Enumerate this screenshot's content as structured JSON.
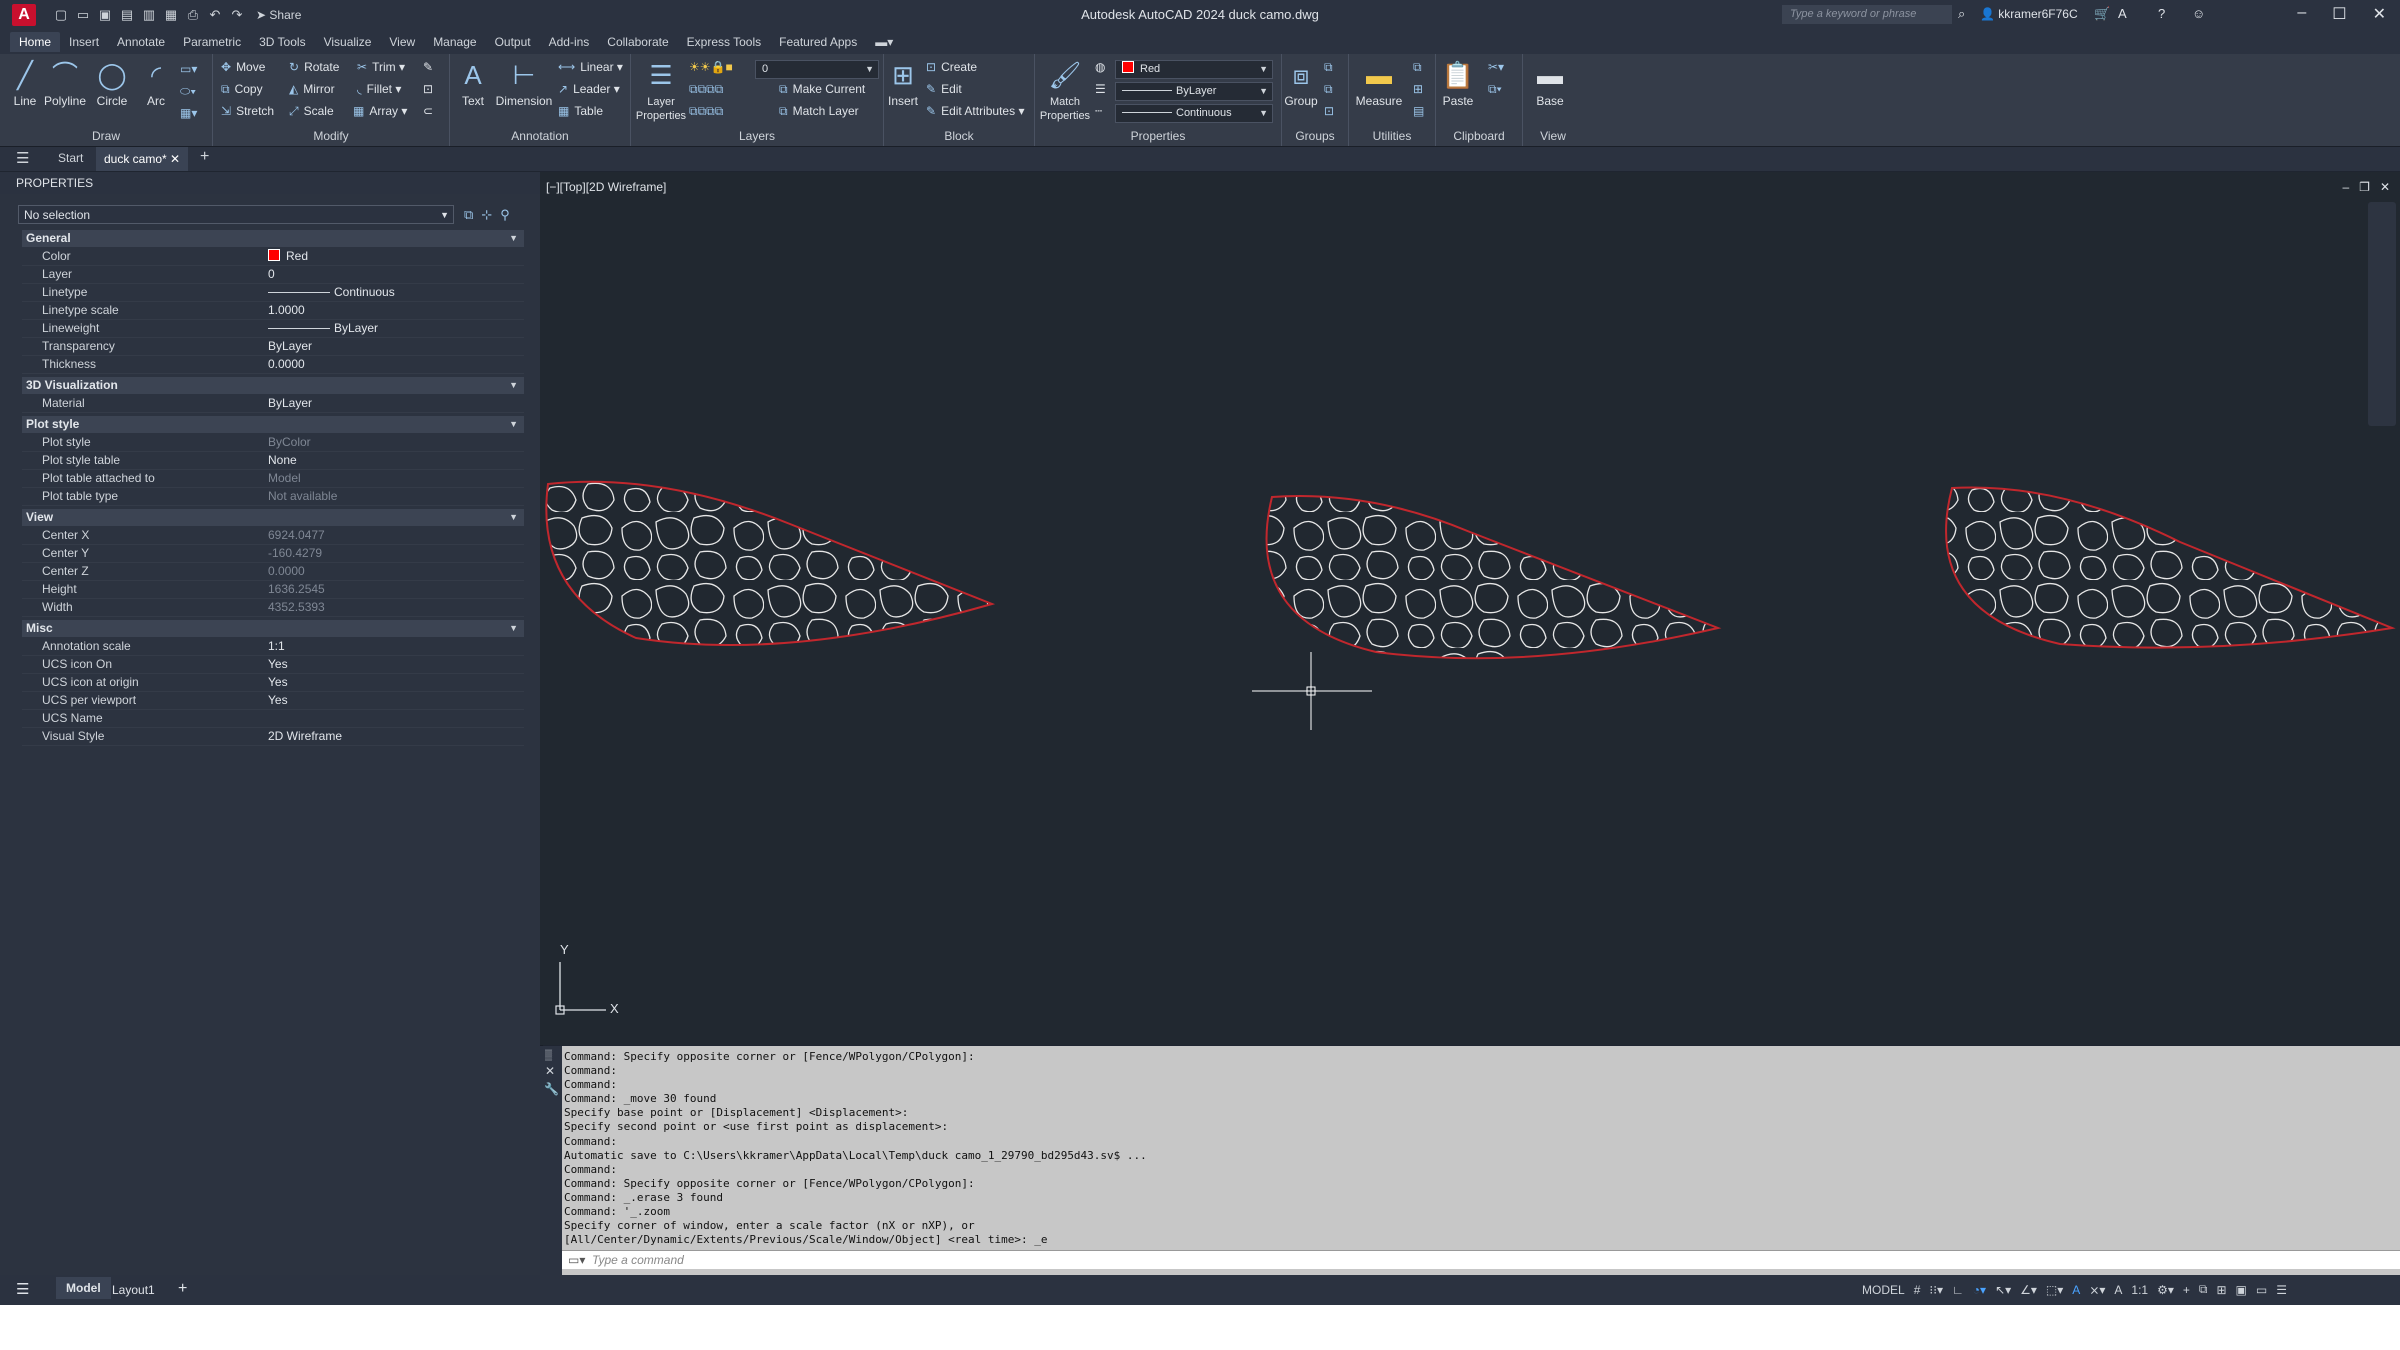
{
  "app": {
    "logo_letter": "A",
    "title": "Autodesk AutoCAD 2024   duck camo.dwg",
    "share_label": "Share",
    "search_placeholder": "Type a keyword or phrase",
    "username": "kkramer6F76C"
  },
  "menu_tabs": [
    "Home",
    "Insert",
    "Annotate",
    "Parametric",
    "3D Tools",
    "Visualize",
    "View",
    "Manage",
    "Output",
    "Add-ins",
    "Collaborate",
    "Express Tools",
    "Featured Apps"
  ],
  "ribbon": {
    "draw": {
      "title": "Draw",
      "line": "Line",
      "polyline": "Polyline",
      "circle": "Circle",
      "arc": "Arc"
    },
    "modify": {
      "title": "Modify",
      "move": "Move",
      "rotate": "Rotate",
      "trim": "Trim",
      "copy": "Copy",
      "mirror": "Mirror",
      "fillet": "Fillet",
      "stretch": "Stretch",
      "scale": "Scale",
      "array": "Array"
    },
    "annotation": {
      "title": "Annotation",
      "text": "Text",
      "dimension": "Dimension",
      "linear": "Linear",
      "leader": "Leader",
      "table": "Table"
    },
    "layers": {
      "title": "Layers",
      "layer_properties": "Layer Properties",
      "current_layer": "0",
      "make_current": "Make Current",
      "match_layer": "Match Layer"
    },
    "block": {
      "title": "Block",
      "insert": "Insert",
      "create": "Create",
      "edit": "Edit",
      "edit_attributes": "Edit Attributes"
    },
    "properties": {
      "title": "Properties",
      "match_properties": "Match Properties",
      "color": "Red",
      "lineweight": "ByLayer",
      "linetype": "Continuous"
    },
    "groups": {
      "title": "Groups",
      "group": "Group"
    },
    "utilities": {
      "title": "Utilities",
      "measure": "Measure"
    },
    "clipboard": {
      "title": "Clipboard",
      "paste": "Paste"
    },
    "view": {
      "title": "View",
      "base": "Base"
    }
  },
  "file_tabs": {
    "start": "Start",
    "active": "duck camo*"
  },
  "palette": {
    "title": "PROPERTIES",
    "selection": "No selection",
    "sections": {
      "general": "General",
      "viz": "3D Visualization",
      "plot": "Plot style",
      "view": "View",
      "misc": "Misc"
    },
    "general": [
      {
        "name": "Color",
        "value": "Red"
      },
      {
        "name": "Layer",
        "value": "0"
      },
      {
        "name": "Linetype",
        "value": "Continuous"
      },
      {
        "name": "Linetype scale",
        "value": "1.0000"
      },
      {
        "name": "Lineweight",
        "value": "ByLayer"
      },
      {
        "name": "Transparency",
        "value": "ByLayer"
      },
      {
        "name": "Thickness",
        "value": "0.0000"
      }
    ],
    "viz": [
      {
        "name": "Material",
        "value": "ByLayer"
      }
    ],
    "plot": [
      {
        "name": "Plot style",
        "value": "ByColor"
      },
      {
        "name": "Plot style table",
        "value": "None"
      },
      {
        "name": "Plot table attached to",
        "value": "Model"
      },
      {
        "name": "Plot table type",
        "value": "Not available"
      }
    ],
    "view": [
      {
        "name": "Center X",
        "value": "6924.0477"
      },
      {
        "name": "Center Y",
        "value": "-160.4279"
      },
      {
        "name": "Center Z",
        "value": "0.0000"
      },
      {
        "name": "Height",
        "value": "1636.2545"
      },
      {
        "name": "Width",
        "value": "4352.5393"
      }
    ],
    "misc": [
      {
        "name": "Annotation scale",
        "value": "1:1"
      },
      {
        "name": "UCS icon On",
        "value": "Yes"
      },
      {
        "name": "UCS icon at origin",
        "value": "Yes"
      },
      {
        "name": "UCS per viewport",
        "value": "Yes"
      },
      {
        "name": "UCS Name",
        "value": ""
      },
      {
        "name": "Visual Style",
        "value": "2D Wireframe"
      }
    ]
  },
  "viewport": {
    "label": "[−][Top][2D Wireframe]",
    "ucs_x": "X",
    "ucs_y": "Y"
  },
  "command": {
    "history": "Command: Specify opposite corner or [Fence/WPolygon/CPolygon]:\nCommand:\nCommand:\nCommand: _move 30 found\nSpecify base point or [Displacement] <Displacement>:\nSpecify second point or <use first point as displacement>:\nCommand:\nAutomatic save to C:\\Users\\kkramer\\AppData\\Local\\Temp\\duck camo_1_29790_bd295d43.sv$ ...\nCommand:\nCommand: Specify opposite corner or [Fence/WPolygon/CPolygon]:\nCommand: _.erase 3 found\nCommand: '_.zoom\nSpecify corner of window, enter a scale factor (nX or nXP), or\n[All/Center/Dynamic/Extents/Previous/Scale/Window/Object] <real time>: _e",
    "placeholder": "Type a command"
  },
  "status": {
    "model_tab": "Model",
    "layout_tab": "Layout1",
    "model_label": "MODEL",
    "scale": "1:1"
  }
}
